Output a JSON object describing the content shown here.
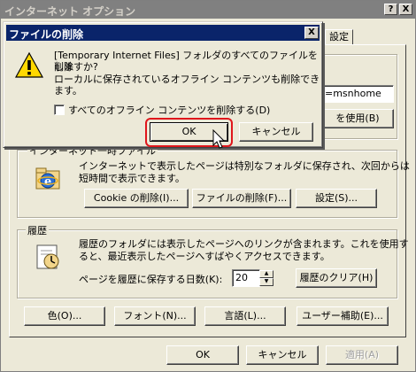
{
  "window": {
    "title": "インターネット オプション",
    "help_btn": "?",
    "close_btn": "X",
    "tab_partial": "設定"
  },
  "homepage": {
    "address_value_partial": "=msnhome",
    "use_button_partial": "を使用(B)"
  },
  "temp_files": {
    "group_label_partial": "インターネット一時ファイル",
    "description": "インターネットで表示したページは特別なフォルダに保存され、次回からは短時間で表示できます。",
    "desc_line1": "インターネットで表示したページは特別なフォルダに保存され、次回からは",
    "desc_line2": "短時間で表示できます。",
    "cookie_button": "Cookie の削除(I)...",
    "delete_files_button": "ファイルの削除(F)...",
    "settings_button": "設定(S)..."
  },
  "history": {
    "group_label": "履歴",
    "desc_line1": "履歴のフォルダには表示したページへのリンクが含まれます。これを使用す",
    "desc_line2": "ると、最近表示したページへすばやくアクセスできます。",
    "days_label": "ページを履歴に保存する日数(K):",
    "days_value": "20",
    "clear_button": "履歴のクリア(H)"
  },
  "bottom_buttons": {
    "colors": "色(O)...",
    "fonts": "フォント(N)...",
    "languages": "言語(L)...",
    "accessibility": "ユーザー補助(E)..."
  },
  "footer": {
    "ok": "OK",
    "cancel": "キャンセル",
    "apply": "適用(A)"
  },
  "dialog": {
    "title": "ファイルの削除",
    "close_btn": "X",
    "message_line1": "[Temporary Internet Files] フォルダのすべてのファイルを削除",
    "message_line2": "しますか?",
    "message_line3": "ローカルに保存されているオフライン コンテンツも削除できます。",
    "checkbox_label": "すべてのオフライン コンテンツを削除する(D)",
    "checkbox_checked": false,
    "ok": "OK",
    "cancel": "キャンセル"
  },
  "colors": {
    "dialog_titlebar": "#0a246a",
    "inactive_titlebar": "#808080",
    "highlight_ring": "#e0161c",
    "face": "#ece9d8"
  }
}
